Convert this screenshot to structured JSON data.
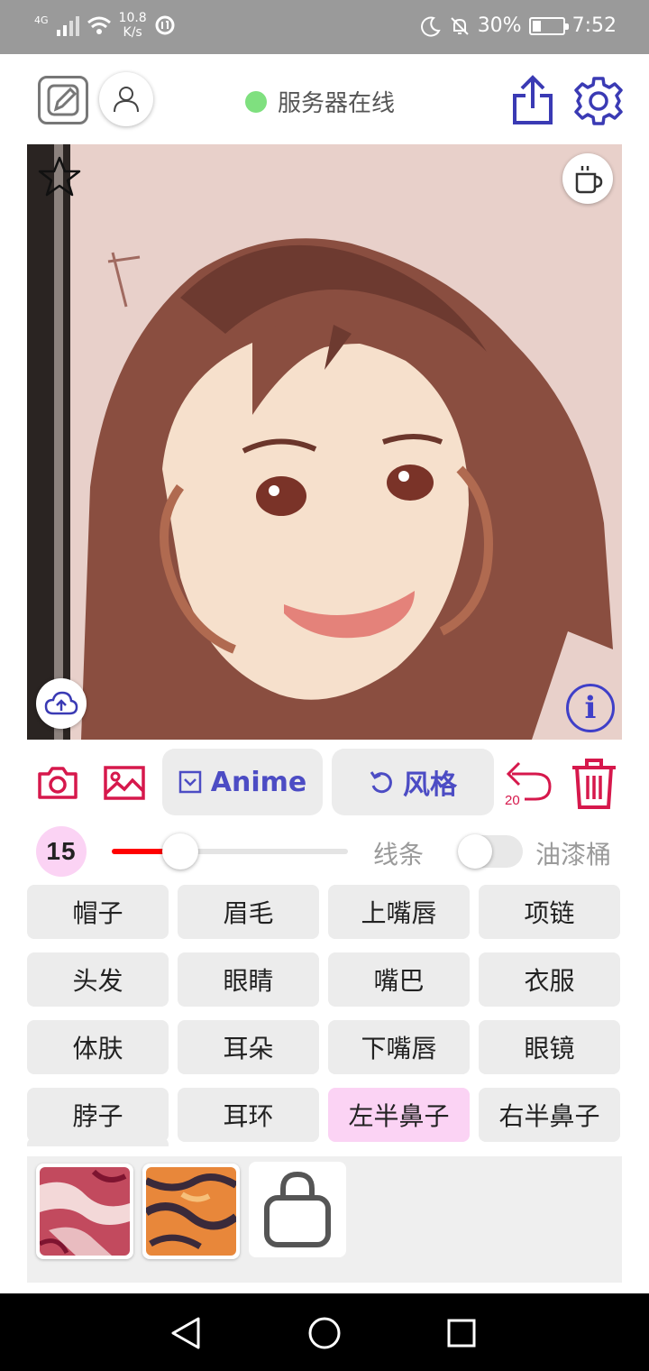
{
  "status_bar": {
    "network": "4G",
    "speed_value": "10.8",
    "speed_unit": "K/s",
    "battery_percent": "30%",
    "battery_level": 0.3,
    "time": "7:52",
    "icons": [
      "signal-icon",
      "wifi-icon",
      "data-saver-icon",
      "moon-icon",
      "bell-off-icon",
      "battery-icon"
    ]
  },
  "header": {
    "server_status": "服务器在线",
    "server_status_color": "#7fe07f",
    "icons": [
      "edit-icon",
      "profile-icon",
      "share-icon",
      "settings-icon"
    ]
  },
  "canvas": {
    "icons": [
      "star-icon",
      "coffee-icon",
      "cloud-upload-icon",
      "info-icon"
    ],
    "info_glyph": "i"
  },
  "toolbar": {
    "anime_label": "Anime",
    "style_label": "风格",
    "undo_count": "20",
    "accent_color": "#4c4cc4",
    "danger_color": "#d6184c",
    "icons": [
      "camera-icon",
      "image-icon",
      "checkbox-icon",
      "rotate-left-icon",
      "undo-icon",
      "trash-icon"
    ]
  },
  "brush": {
    "size": "15",
    "slider_fraction": 0.29,
    "line_label": "线条",
    "bucket_label": "油漆桶",
    "bucket_enabled": false
  },
  "parts": [
    {
      "label": "帽子",
      "active": false
    },
    {
      "label": "眉毛",
      "active": false
    },
    {
      "label": "上嘴唇",
      "active": false
    },
    {
      "label": "项链",
      "active": false
    },
    {
      "label": "头发",
      "active": false
    },
    {
      "label": "眼睛",
      "active": false
    },
    {
      "label": "嘴巴",
      "active": false
    },
    {
      "label": "衣服",
      "active": false
    },
    {
      "label": "体肤",
      "active": false
    },
    {
      "label": "耳朵",
      "active": false
    },
    {
      "label": "下嘴唇",
      "active": false
    },
    {
      "label": "眼镜",
      "active": false
    },
    {
      "label": "脖子",
      "active": false
    },
    {
      "label": "耳环",
      "active": false
    },
    {
      "label": "左半鼻子",
      "active": true
    },
    {
      "label": "右半鼻子",
      "active": false
    }
  ],
  "textures": {
    "icons": [
      "texture-red-swatch",
      "texture-orange-swatch",
      "shopping-bag-icon"
    ]
  },
  "navbar": {
    "icons": [
      "back-icon",
      "home-icon",
      "recents-icon"
    ]
  }
}
